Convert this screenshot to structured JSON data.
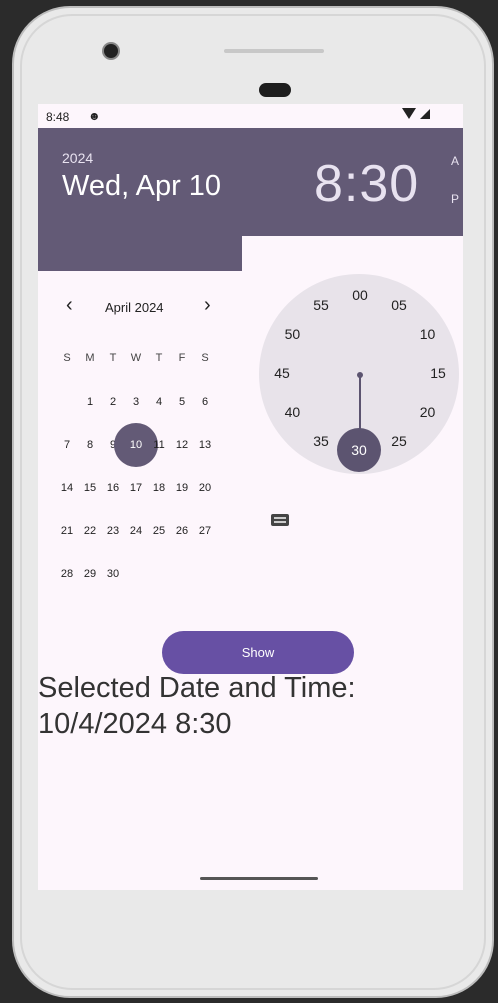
{
  "status_bar": {
    "time": "8:48",
    "app_icon": "android-icon",
    "wifi_icon": "wifi-icon",
    "signal_icon": "signal-icon"
  },
  "picker_header": {
    "year": "2024",
    "date": "Wed, Apr 10",
    "time": "8:30",
    "am_label": "A",
    "pm_label": "P"
  },
  "calendar": {
    "prev_icon": "chevron-left-icon",
    "next_icon": "chevron-right-icon",
    "month_title": "April 2024",
    "weekdays": [
      "S",
      "M",
      "T",
      "W",
      "T",
      "F",
      "S"
    ],
    "weeks": [
      [
        "",
        "1",
        "2",
        "3",
        "4",
        "5",
        "6"
      ],
      [
        "7",
        "8",
        "9",
        "10",
        "11",
        "12",
        "13"
      ],
      [
        "14",
        "15",
        "16",
        "17",
        "18",
        "19",
        "20"
      ],
      [
        "21",
        "22",
        "23",
        "24",
        "25",
        "26",
        "27"
      ],
      [
        "28",
        "29",
        "30",
        "",
        "",
        "",
        ""
      ]
    ],
    "selected_day": "10"
  },
  "clock": {
    "numbers": [
      "00",
      "05",
      "10",
      "15",
      "20",
      "25",
      "30",
      "35",
      "40",
      "45",
      "50",
      "55"
    ],
    "selected": "30",
    "keyboard_icon": "keyboard-icon"
  },
  "show_button": {
    "label": "Show"
  },
  "result": {
    "line1": "Selected Date and Time:",
    "line2": "10/4/2024 8:30"
  },
  "colors": {
    "header": "#635a76",
    "button": "#6750a4",
    "screen_bg": "#fdf6fc",
    "clock_bg": "#e8e3ea"
  }
}
